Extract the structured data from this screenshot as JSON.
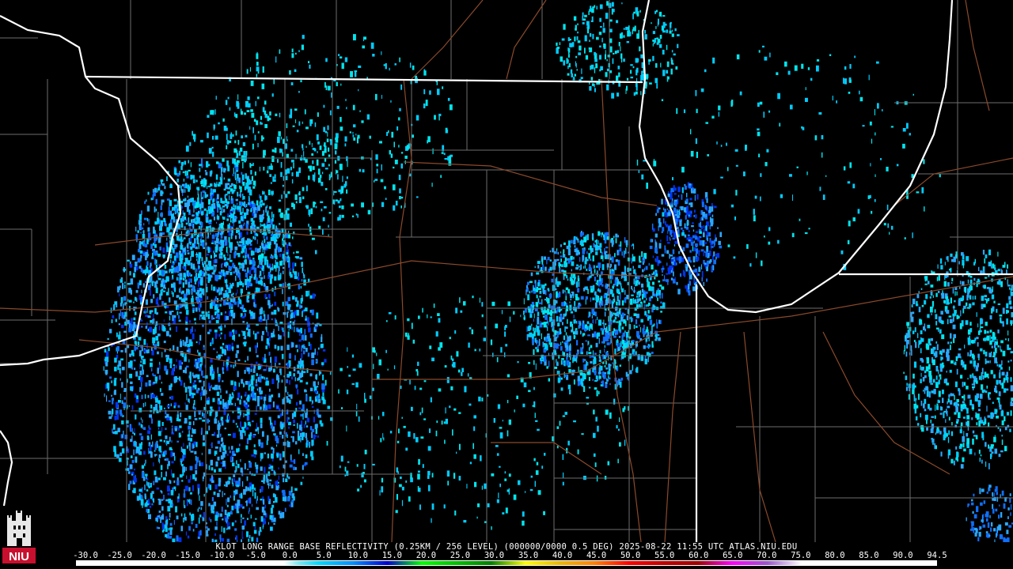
{
  "product_caption": "KLOT LONG RANGE BASE REFLECTIVITY (0.25KM / 256 LEVEL) (000000/0000 0.5 DEG) 2025-08-22 11:55 UTC  ATLAS.NIU.EDU",
  "scale": {
    "labels": [
      "-30.0",
      "-25.0",
      "-20.0",
      "-15.0",
      "-10.0",
      "-5.0",
      "0.0",
      "5.0",
      "10.0",
      "15.0",
      "20.0",
      "25.0",
      "30.0",
      "35.0",
      "40.0",
      "45.0",
      "50.0",
      "55.0",
      "60.0",
      "65.0",
      "70.0",
      "75.0",
      "80.0",
      "85.0",
      "90.0",
      "94.5"
    ],
    "min": -30,
    "max": 94.5,
    "gradient_stops": [
      {
        "value": -30,
        "color": "#ffffff"
      },
      {
        "value": 0,
        "color": "#ffffff"
      },
      {
        "value": 2,
        "color": "#7fe8f0"
      },
      {
        "value": 5,
        "color": "#00d8ff"
      },
      {
        "value": 10,
        "color": "#0090ff"
      },
      {
        "value": 15,
        "color": "#0000d0"
      },
      {
        "value": 20,
        "color": "#00ff00"
      },
      {
        "value": 25,
        "color": "#00c000"
      },
      {
        "value": 30,
        "color": "#008000"
      },
      {
        "value": 35,
        "color": "#ffff00"
      },
      {
        "value": 40,
        "color": "#e8b800"
      },
      {
        "value": 45,
        "color": "#ff8000"
      },
      {
        "value": 50,
        "color": "#ff0000"
      },
      {
        "value": 55,
        "color": "#c00000"
      },
      {
        "value": 60,
        "color": "#a00000"
      },
      {
        "value": 65,
        "color": "#ff00ff"
      },
      {
        "value": 70,
        "color": "#9955cc"
      },
      {
        "value": 75,
        "color": "#ffffff"
      },
      {
        "value": 94.5,
        "color": "#ffffff"
      }
    ]
  },
  "logo": {
    "text": "NIU",
    "icon": "niu-castle-icon",
    "color": "#c8102e"
  },
  "map": {
    "background": "#000000",
    "state_border_color": "#ffffff",
    "county_line_color": "#6e6e6e",
    "road_color": "#8b4a2b",
    "echo_colors": [
      "#00ccff",
      "#2aa8ff",
      "#0f6fff",
      "#0033ee",
      "#00e5ee"
    ]
  }
}
